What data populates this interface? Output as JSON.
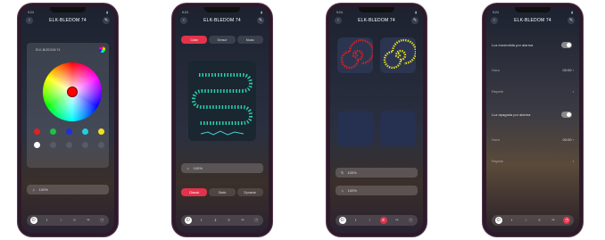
{
  "device": {
    "name": "ELK-BLEDOM 74"
  },
  "status_time": "9:24",
  "phone1": {
    "device_label": "ELK-BLEDOM 74",
    "brightness": "100%",
    "swatches": [
      "#e02020",
      "#20c040",
      "#2030e0",
      "#20d0e0",
      "#f0e020",
      "#ffffff"
    ]
  },
  "phone2": {
    "segments": [
      "Color",
      "Sensor",
      "Music"
    ],
    "brightness": "100%",
    "modes": [
      "Classic",
      "Static",
      "Dynamic"
    ]
  },
  "phone3": {
    "tile_labels": [
      "",
      "",
      "",
      ""
    ],
    "speed": "100%",
    "brightness": "100%"
  },
  "phone4": {
    "on_alarm_label": "Luz encendida por alarma",
    "off_alarm_label": "Luz apagada por alarma",
    "hora_label": "Hora",
    "hora_value": "00:00",
    "repeat_label": "Repetir"
  },
  "colors": {
    "accent": "#e2334b",
    "wheel_selected": "#ff0000"
  }
}
